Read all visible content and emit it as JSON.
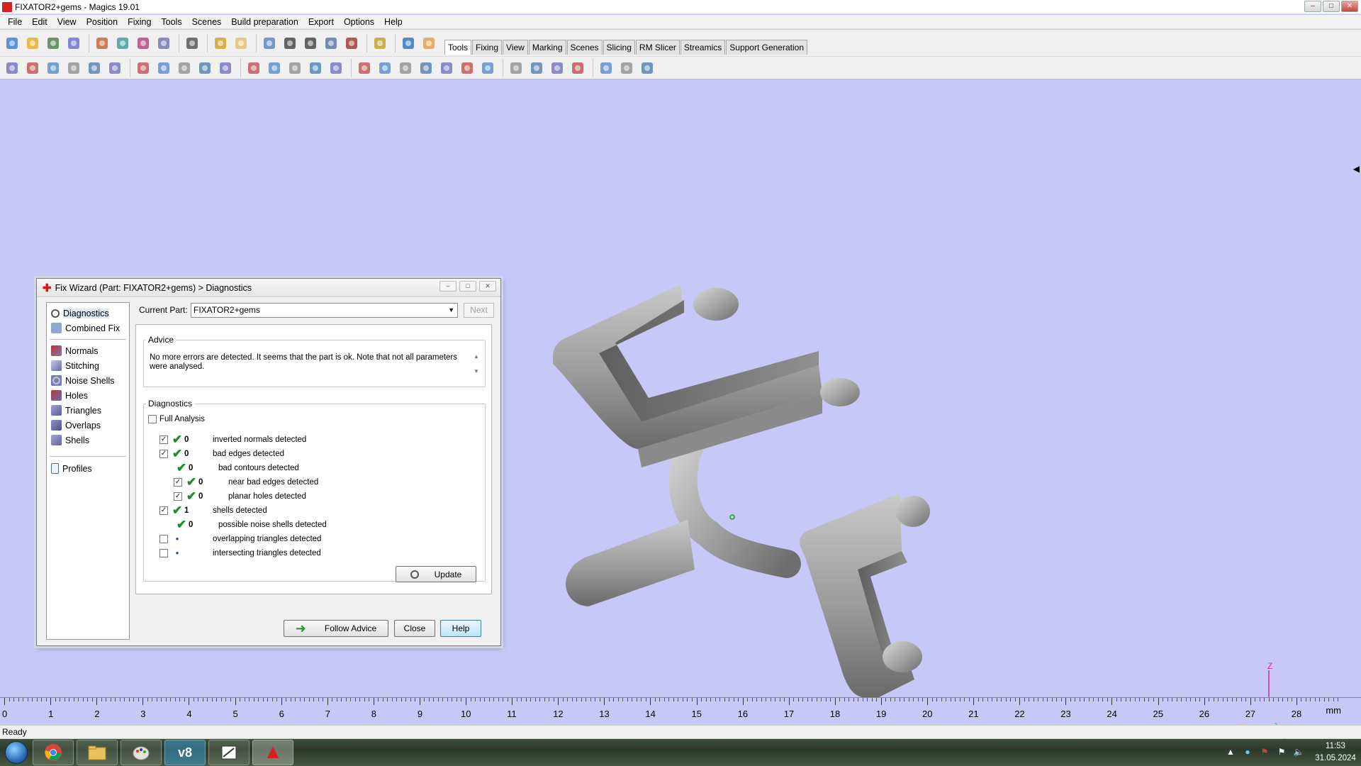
{
  "window": {
    "title": "FIXATOR2+gems - Magics 19.01"
  },
  "menubar": [
    "File",
    "Edit",
    "View",
    "Position",
    "Fixing",
    "Tools",
    "Scenes",
    "Build preparation",
    "Export",
    "Options",
    "Help"
  ],
  "ribbon_tabs": [
    "Tools",
    "Fixing",
    "View",
    "Marking",
    "Scenes",
    "Slicing",
    "RM Slicer",
    "Streamics",
    "Support Generation"
  ],
  "ribbon_active_tab": "Tools",
  "toolbar1_icons": [
    "new-file-icon",
    "open-folder-icon",
    "save-icon",
    "save-as-icon",
    "import-part-icon",
    "save-part-icon",
    "load-icon",
    "unload-icon",
    "print-icon",
    "undo-icon",
    "redo-icon",
    "select-part-icon",
    "rotate-view-icon",
    "pan-icon",
    "zoom-icon",
    "zoom-fit-icon",
    "fix-wizard-icon",
    "help-icon",
    "whats-this-icon"
  ],
  "toolbar2_icons": [
    "translate-icon",
    "translate-default-icon",
    "rotate-icon",
    "rotate-default-icon",
    "mirror-icon",
    "rescale-icon",
    "duplicate-icon",
    "cut-icon",
    "split-icon",
    "merge-icon",
    "hollow-icon",
    "extrude-icon",
    "offset-icon",
    "boolean-icon",
    "label-icon",
    "measure-icon",
    "section-icon",
    "triangle-reduction-icon",
    "smooth-icon",
    "wrap-icon",
    "shell-icon",
    "thickness-icon",
    "collision-icon",
    "nesting-icon",
    "sinter-box-icon",
    "compare-icon",
    "explode-icon",
    "mesh-quality-icon",
    "curvature-icon",
    "package-icon"
  ],
  "viewport": {
    "background": "#c8c8f8",
    "model_color": "#9a9a9a"
  },
  "axes": {
    "z": "Z",
    "y": "Y",
    "x": "X"
  },
  "ruler": {
    "ticks": [
      "0",
      "1",
      "2",
      "3",
      "4",
      "5",
      "6",
      "7",
      "8",
      "9",
      "10",
      "11",
      "12",
      "13",
      "14",
      "15",
      "16",
      "17",
      "18",
      "19",
      "20",
      "21",
      "22",
      "23",
      "24",
      "25",
      "26",
      "27",
      "28"
    ],
    "unit": "mm"
  },
  "statusbar": {
    "text": "Ready"
  },
  "taskbar": {
    "apps": [
      "chrome-icon",
      "explorer-icon",
      "paint-icon",
      "v8-icon",
      "magics-snip-icon",
      "magics-icon"
    ],
    "clock_time": "11:53",
    "clock_date": "31.05.2024"
  },
  "wizard": {
    "title": "Fix Wizard (Part: FIXATOR2+gems) > Diagnostics",
    "nav_top": [
      "Diagnostics",
      "Combined Fix"
    ],
    "nav_tools": [
      "Normals",
      "Stitching",
      "Noise Shells",
      "Holes",
      "Triangles",
      "Overlaps",
      "Shells"
    ],
    "nav_bottom": [
      "Profiles"
    ],
    "current_part_label": "Current Part:",
    "current_part": "FIXATOR2+gems",
    "next_label": "Next",
    "advice_legend": "Advice",
    "advice_text": "No more errors are detected. It seems that the part is ok. Note that not all parameters were analysed.",
    "diagnostics_legend": "Diagnostics",
    "full_analysis_label": "Full Analysis",
    "rows": [
      {
        "checked": "✓",
        "status": "ok",
        "count": "0",
        "label": "inverted normals detected"
      },
      {
        "checked": "✓",
        "status": "ok",
        "count": "0",
        "label": "bad edges detected"
      },
      {
        "checked": "",
        "status": "ok",
        "count": "0",
        "label": "bad contours detected"
      },
      {
        "checked": "✓",
        "status": "ok",
        "count": "0",
        "label": "near bad edges detected"
      },
      {
        "checked": "✓",
        "status": "ok",
        "count": "0",
        "label": "planar holes detected"
      },
      {
        "checked": "✓",
        "status": "ok",
        "count": "1",
        "label": "shells detected"
      },
      {
        "checked": "",
        "status": "ok",
        "count": "0",
        "label": "possible noise shells detected"
      },
      {
        "checked": "",
        "status": "pending",
        "count": "",
        "label": "overlapping triangles detected"
      },
      {
        "checked": "",
        "status": "pending",
        "count": "",
        "label": "intersecting triangles detected"
      }
    ],
    "update_label": "Update",
    "follow_advice_label": "Follow Advice",
    "close_label": "Close",
    "help_label": "Help"
  }
}
